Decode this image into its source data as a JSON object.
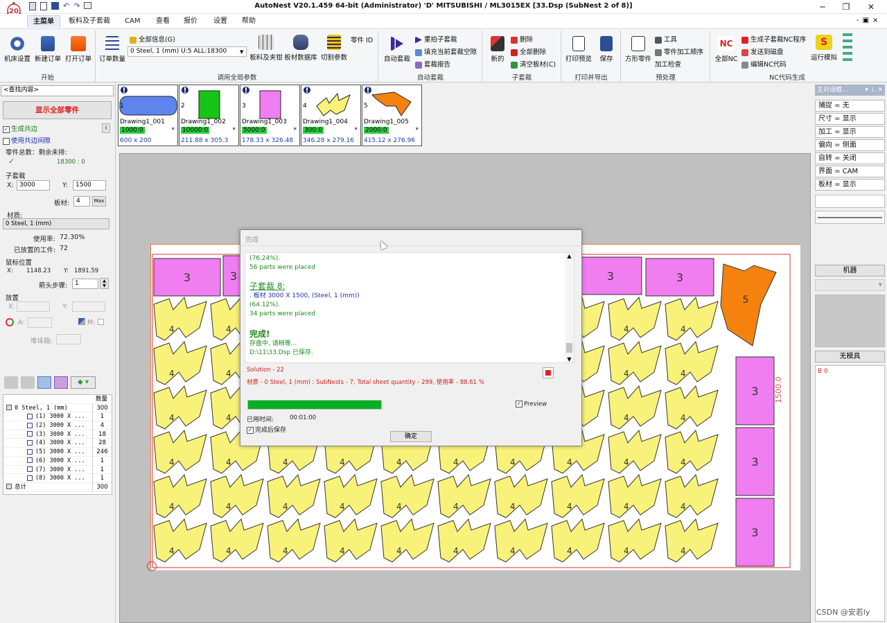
{
  "window": {
    "title": "AutoNest V20.1.459 64-bit (Administrator)      'D' MITSUBISHI / ML3015EX    [33.Dsp (SubNest 2 of 8)]"
  },
  "quick_access": [
    "文件",
    "预览",
    "保存",
    "撤销",
    "重做",
    "打印"
  ],
  "tabs": [
    "主菜单",
    "板料及子套裁",
    "CAM",
    "查看",
    "报价",
    "设置",
    "帮助"
  ],
  "active_tab": "主菜单",
  "ribbon": {
    "groups": {
      "start": "开始",
      "global_params": "调用全局参数",
      "auto_nest": "自动套裁",
      "subnest": "子套裁",
      "print_export": "打印并导出",
      "preprocess": "预处理",
      "nc_gen": "NC代码生成"
    },
    "start": {
      "machine": "机床设置",
      "new_order": "新建订单",
      "open_order": "打开订单"
    },
    "global_params": {
      "order_qty": "订单数量",
      "all_info": "全部信息(G)",
      "material_combo": "0  Steel, 1 (mm)    U:5 ALL:18300",
      "sheet_fixture": "板料及夹钳",
      "sheet_db": "板材数据库",
      "cut_params": "切割参数",
      "part_id": "零件 ID"
    },
    "auto_nest": {
      "auto": "自动套裁",
      "renest": "重拍子套裁",
      "fill_blank": "填充当前套裁空隙",
      "report": "套裁报告"
    },
    "subnest": {
      "new": "新的",
      "delete": "删除",
      "delete_all": "全部删除",
      "clear_sheet": "清空板材(C)"
    },
    "print_export": {
      "print_preview": "打印预览",
      "save": "保存"
    },
    "preprocess": {
      "square_part": "方形零件",
      "tool": "工具",
      "process_order": "零件加工顺序",
      "process_check": "加工检查"
    },
    "nc_gen": {
      "all_nc": "全部NC",
      "gen_sub_nc": "生成子套裁NC程序",
      "send_disk": "发送到磁盘",
      "edit_nc": "编辑NC代码",
      "run_sim": "运行模拟"
    }
  },
  "left_panel": {
    "search_placeholder": "<查找内容>",
    "show_all_parts": "显示全部零件",
    "gen_common": "生成共边",
    "use_common_gap": "使用共边间隙",
    "info_btn": "i",
    "parts_total_label": "零件总数：剩余未排:",
    "parts_total_value": "18300 : 0",
    "subnest_label": "子套裁",
    "x_label": "X:",
    "x_value": "3000",
    "y_label": "Y:",
    "y_value": "1500",
    "sheet_label": "板材:",
    "sheet_value": "4",
    "max_btn": "Max",
    "material_label": "材质:",
    "material_value": "0  Steel, 1 (mm)",
    "usage_label": "使用率:",
    "usage_value": "72.30%",
    "placed_label": "已放置的工件:",
    "placed_value": "72",
    "mouse_label": "鼠标位置",
    "mouse_x_label": "X:",
    "mouse_x": "1148.23",
    "mouse_y_label": "Y:",
    "mouse_y": "1891.59",
    "arrow_step_label": "箭头步骤:",
    "arrow_step_value": "1",
    "place_label": "放置",
    "place_x_label": "X:",
    "place_y_label": "Y:",
    "place_a_label": "A:",
    "place_m_label": "M:",
    "stack_label": "堆垛箱:",
    "tree_header_qty": "数量",
    "tree": [
      {
        "label": "0  Steel, 1 (mm)",
        "qty": "300",
        "level": 0
      },
      {
        "label": "(1) 3000 X ...",
        "qty": "1",
        "level": 1
      },
      {
        "label": "(2) 3000 X ...",
        "qty": "4",
        "level": 1
      },
      {
        "label": "(3) 3000 X ...",
        "qty": "18",
        "level": 1
      },
      {
        "label": "(4) 3000 X ...",
        "qty": "28",
        "level": 1
      },
      {
        "label": "(5) 3000 X ...",
        "qty": "246",
        "level": 1
      },
      {
        "label": "(6) 3000 X ...",
        "qty": "1",
        "level": 1
      },
      {
        "label": "(7) 3000 X ...",
        "qty": "1",
        "level": 1
      },
      {
        "label": "(8) 3000 X ...",
        "qty": "1",
        "level": 1
      },
      {
        "label": "总计",
        "qty": "300",
        "level": 0
      }
    ]
  },
  "parts": [
    {
      "num": "1",
      "name": "Drawing1_001",
      "qty": "1000:0",
      "dim": "600 x 200",
      "color": "#5f84ee",
      "shape": "rounded"
    },
    {
      "num": "2",
      "name": "Drawing1_002",
      "qty": "10000:0",
      "dim": "211.88 x 305.3",
      "color": "#17c417",
      "shape": "rect"
    },
    {
      "num": "3",
      "name": "Drawing1_003",
      "qty": "5000:0",
      "dim": "178.33 x 326.48",
      "color": "#f07ef0",
      "shape": "rect"
    },
    {
      "num": "4",
      "name": "Drawing1_004",
      "qty": "300:0",
      "dim": "346.28 x 279.16",
      "color": "#f8f27a",
      "shape": "zigzag"
    },
    {
      "num": "5",
      "name": "Drawing1_005",
      "qty": "2000:0",
      "dim": "415.12 x 276.96",
      "color": "#f5820f",
      "shape": "notch"
    }
  ],
  "part_star": "*",
  "right_panel": {
    "header": "主对话框...",
    "rows": [
      "捕捉 = 无",
      "尺寸 = 显示",
      "加工 = 显示",
      "偏向 = 侧面",
      "自转 = 关闭",
      "界面 = CAM",
      "板材 = 显示"
    ],
    "machine_btn": "机器",
    "no_tool_btn": "无模具",
    "b_value": "B 0"
  },
  "sheet": {
    "dim_label": "1500.0",
    "part3_label": "3",
    "part4_label": "4",
    "part5_label": "5"
  },
  "dialog": {
    "title": "完成",
    "log": [
      {
        "text": "(76.24%).",
        "color": "#1e8b1e",
        "style": "normal"
      },
      {
        "text": "56 parts were placed",
        "color": "#1e8b1e",
        "style": "normal"
      },
      {
        "text": "子套裁 8:",
        "color": "#1e8b1e",
        "style": "heading"
      },
      {
        "text": ".   板材 3000 X 1500, (Steel, 1 (mm))",
        "color": "#1a2fb0",
        "style": "normal"
      },
      {
        "text": "(64.12%).",
        "color": "#1e8b1e",
        "style": "normal"
      },
      {
        "text": "34 parts were placed",
        "color": "#1e8b1e",
        "style": "normal"
      },
      {
        "text": "完成!",
        "color": "#1e8b1e",
        "style": "bold"
      },
      {
        "text": "存盘中, 请稍等...",
        "color": "#1e8b1e",
        "style": "normal"
      },
      {
        "text": "D:\\11\\33.Dsp 已保存.",
        "color": "#1e8b1e",
        "style": "normal"
      }
    ],
    "solution": "Solution - 22",
    "summary": "材质 - 0  Steel, 1 (mm) : SubNests - 7, Total sheet quantity - 299, 使用率 - 88.61 %",
    "preview_label": "Preview",
    "progress": 1.0,
    "elapsed_label": "已用时间:",
    "elapsed_value": "00:01:00",
    "save_after": "完成后保存",
    "ok": "确定"
  },
  "watermark": "CSDN @安若ly"
}
